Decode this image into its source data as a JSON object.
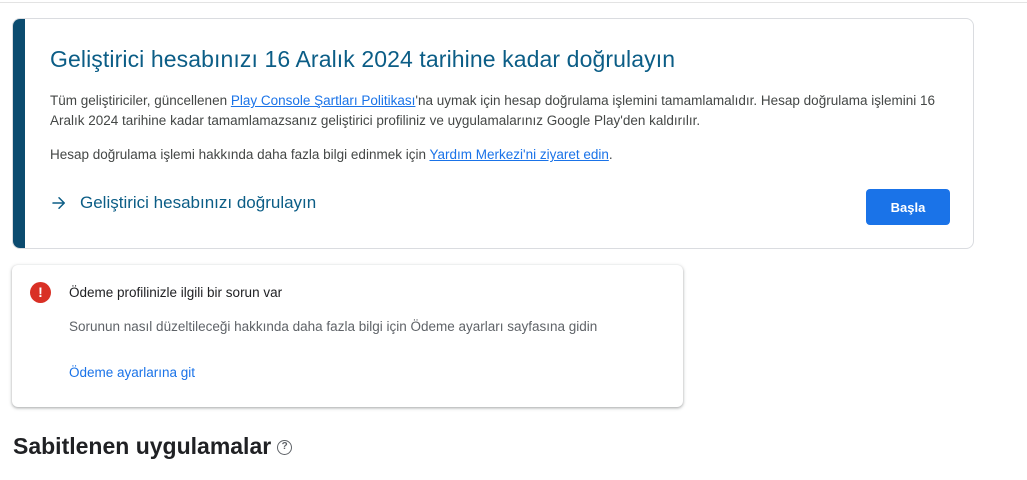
{
  "verification": {
    "title": "Geliştirici hesabınızı 16 Aralık 2024 tarihine kadar doğrulayın",
    "body_prefix": "Tüm geliştiriciler, güncellenen ",
    "body_link": "Play Console Şartları Politikası",
    "body_suffix": "'na uymak için hesap doğrulama işlemini tamamlamalıdır. Hesap doğrulama işlemini 16 Aralık 2024 tarihine kadar tamamlamazsanız geliştirici profiliniz ve uygulamalarınız Google Play'den kaldırılır.",
    "help_prefix": "Hesap doğrulama işlemi hakkında daha fazla bilgi edinmek için ",
    "help_link": "Yardım Merkezi'ni ziyaret edin",
    "help_suffix": ".",
    "action_label": "Geliştirici hesabınızı doğrulayın",
    "start_button": "Başla",
    "accent_color": "#0b4b6f"
  },
  "payment_issue": {
    "icon": "error-icon",
    "icon_glyph": "!",
    "title": "Ödeme profilinizle ilgili bir sorun var",
    "body": "Sorunun nasıl düzeltileceği hakkında daha fazla bilgi için Ödeme ayarları sayfasına gidin",
    "link": "Ödeme ayarlarına git",
    "error_color": "#d93025"
  },
  "pinned_apps": {
    "title": "Sabitlenen uygulamalar",
    "help_glyph": "?"
  }
}
